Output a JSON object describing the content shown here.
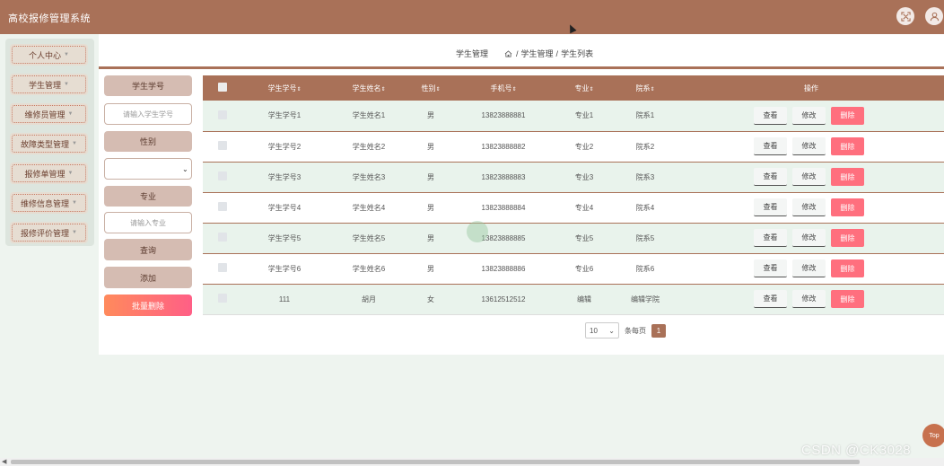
{
  "header": {
    "title": "高校报修管理系统",
    "fullscreen_icon": "expand-icon",
    "user_icon": "user-icon"
  },
  "sidebar": {
    "items": [
      {
        "label": "个人中心"
      },
      {
        "label": "学生管理"
      },
      {
        "label": "维修员管理"
      },
      {
        "label": "故障类型管理"
      },
      {
        "label": "报修单管理"
      },
      {
        "label": "维修信息管理"
      },
      {
        "label": "报修评价管理"
      }
    ]
  },
  "breadcrumb": {
    "section": "学生管理",
    "path1": "学生管理",
    "path2": "学生列表",
    "sep": "/"
  },
  "search": {
    "student_no_label": "学生学号",
    "student_no_placeholder": "请输入学生学号",
    "gender_label": "性别",
    "gender_value": "",
    "major_label": "专业",
    "major_placeholder": "请输入专业",
    "query_button": "查询",
    "add_button": "添加",
    "batch_delete_button": "批量删除"
  },
  "table": {
    "columns": [
      "学生学号",
      "学生姓名",
      "性别",
      "手机号",
      "专业",
      "院系",
      "操作"
    ],
    "sort_glyph": "⇕",
    "actions": {
      "view": "查看",
      "edit": "修改",
      "delete": "删除"
    },
    "rows": [
      {
        "no": "学生学号1",
        "name": "学生姓名1",
        "gender": "男",
        "phone": "13823888881",
        "major": "专业1",
        "dept": "院系1"
      },
      {
        "no": "学生学号2",
        "name": "学生姓名2",
        "gender": "男",
        "phone": "13823888882",
        "major": "专业2",
        "dept": "院系2"
      },
      {
        "no": "学生学号3",
        "name": "学生姓名3",
        "gender": "男",
        "phone": "13823888883",
        "major": "专业3",
        "dept": "院系3"
      },
      {
        "no": "学生学号4",
        "name": "学生姓名4",
        "gender": "男",
        "phone": "13823888884",
        "major": "专业4",
        "dept": "院系4"
      },
      {
        "no": "学生学号5",
        "name": "学生姓名5",
        "gender": "男",
        "phone": "13823888885",
        "major": "专业5",
        "dept": "院系5"
      },
      {
        "no": "学生学号6",
        "name": "学生姓名6",
        "gender": "男",
        "phone": "13823888886",
        "major": "专业6",
        "dept": "院系6"
      },
      {
        "no": "111",
        "name": "胡月",
        "gender": "女",
        "phone": "13612512512",
        "major": "编辑",
        "dept": "编辑学院"
      }
    ]
  },
  "pager": {
    "page_size": "10",
    "per_page_label": "条每页",
    "current_page": "1"
  },
  "top_button": "Top",
  "watermark": "CSDN @CK3028",
  "colors": {
    "primary": "#a97158",
    "delete": "#ff6f7e",
    "row_alt": "#e9f3ec"
  }
}
